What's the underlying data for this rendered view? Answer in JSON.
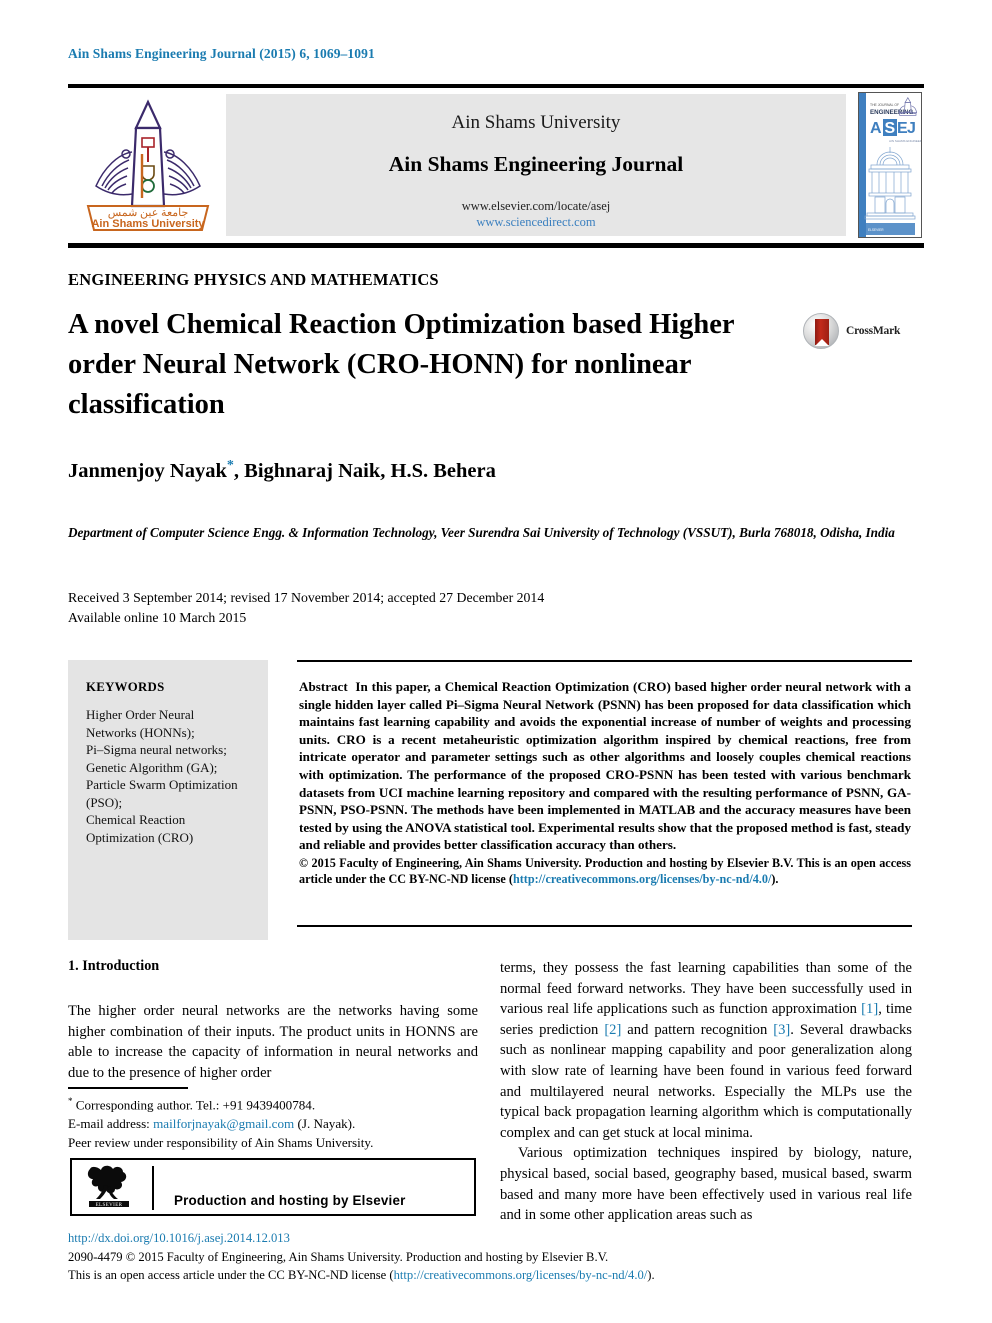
{
  "running_head": "Ain Shams Engineering Journal (2015) 6, 1069–1091",
  "masthead": {
    "university": "Ain Shams University",
    "journal": "Ain Shams Engineering Journal",
    "url_elsevier": "www.elsevier.com/locate/asej",
    "url_sciencedirect": "www.sciencedirect.com",
    "logo_caption_ar": "جامعة عين شمس",
    "logo_caption_en": "Ain Shams University",
    "cover": {
      "kicker": "THE JOURNAL OF",
      "subject": "ENGINEERING",
      "acronym_a": "A",
      "acronym_s": "S",
      "acronym_e": "E",
      "acronym_j": "J",
      "tagline": "AIN SHAMS ENGINEERING JOURNAL",
      "publisher": "ELSEVIER"
    }
  },
  "article": {
    "kicker": "ENGINEERING PHYSICS AND MATHEMATICS",
    "title": "A novel Chemical Reaction Optimization based Higher order Neural Network (CRO-HONN) for nonlinear classification",
    "crossmark_label": "CrossMark",
    "authors": "Janmenjoy Nayak",
    "authors_rest": ", Bighnaraj Naik, H.S. Behera",
    "author_star": "*",
    "affiliation": "Department of Computer Science Engg. & Information Technology, Veer Surendra Sai University of Technology (VSSUT), Burla 768018, Odisha, India",
    "history_line1": "Received 3 September 2014; revised 17 November 2014; accepted 27 December 2014",
    "history_line2": "Available online 10 March 2015"
  },
  "keywords": {
    "heading": "KEYWORDS",
    "items": "Higher Order Neural Networks (HONNs); Pi–Sigma neural networks; Genetic Algorithm (GA); Particle Swarm Optimization (PSO); Chemical Reaction Optimization (CRO)"
  },
  "abstract": {
    "label": "Abstract",
    "text": "In this paper, a Chemical Reaction Optimization (CRO) based higher order neural network with a single hidden layer called Pi–Sigma Neural Network (PSNN) has been proposed for data classification which maintains fast learning capability and avoids the exponential increase of number of weights and processing units. CRO is a recent metaheuristic optimization algorithm inspired by chemical reactions, free from intricate operator and parameter settings such as other algorithms and loosely couples chemical reactions with optimization. The performance of the proposed CRO-PSNN has been tested with various benchmark datasets from UCI machine learning repository and compared with the resulting performance of PSNN, GA-PSNN, PSO-PSNN. The methods have been implemented in MATLAB and the accuracy measures have been tested by using the ANOVA statistical tool. Experimental results show that the proposed method is fast, steady and reliable and provides better classification accuracy than others.",
    "copyright_pre": "© 2015 Faculty of Engineering, Ain Shams University. Production and hosting by Elsevier B.V. This is an open access article under the CC BY-NC-ND license (",
    "copyright_link": "http://creativecommons.org/licenses/by-nc-nd/4.0/",
    "copyright_post": ")."
  },
  "body": {
    "section_heading": "1. Introduction",
    "left_p1": "The higher order neural networks are the networks having some higher combination of their inputs. The product units in HONNS are able to increase the capacity of information in neural networks and due to the presence of higher order",
    "right_p1_a": "terms, they possess the fast learning capabilities than some of the normal feed forward networks. They have been successfully used in various real life applications such as function approximation ",
    "right_ref1": "[1]",
    "right_p1_b": ", time series prediction ",
    "right_ref2": "[2]",
    "right_p1_c": " and pattern recognition ",
    "right_ref3": "[3]",
    "right_p1_d": ". Several drawbacks such as nonlinear mapping capability and poor generalization along with slow rate of learning have been found in various feed forward and multilayered neural networks. Especially the MLPs use the typical back propagation learning algorithm which is computationally complex and can get stuck at local minima.",
    "right_p2": "Various optimization techniques inspired by biology, nature, physical based, social based, geography based, musical based, swarm based and many more have been effectively used in various real life and in some other application areas such as"
  },
  "footnotes": {
    "corresponding": "Corresponding author. Tel.: +91 9439400784.",
    "email_label": "E-mail address: ",
    "email": "mailforjnayak@gmail.com",
    "email_suffix": " (J. Nayak).",
    "peer_review": "Peer review under responsibility of Ain Shams University."
  },
  "production_box": {
    "text": "Production and hosting by Elsevier",
    "logo_label": "ELSEVIER"
  },
  "footer": {
    "doi": "http://dx.doi.org/10.1016/j.asej.2014.12.013",
    "line2": "2090-4479 © 2015 Faculty of Engineering, Ain Shams University. Production and hosting by Elsevier B.V.",
    "line3_pre": "This is an open access article under the CC BY-NC-ND license (",
    "line3_link": "http://creativecommons.org/licenses/by-nc-nd/4.0/",
    "line3_post": ")."
  },
  "colors": {
    "link": "#1a7bb0",
    "masthead_bg": "#e6e6e6",
    "keywords_bg": "#e4e4e4",
    "crossmark_red": "#c32a1b",
    "logo_purple": "#3b2a6b",
    "logo_orange": "#c8661e",
    "cover_blue": "#3f7fbf"
  }
}
